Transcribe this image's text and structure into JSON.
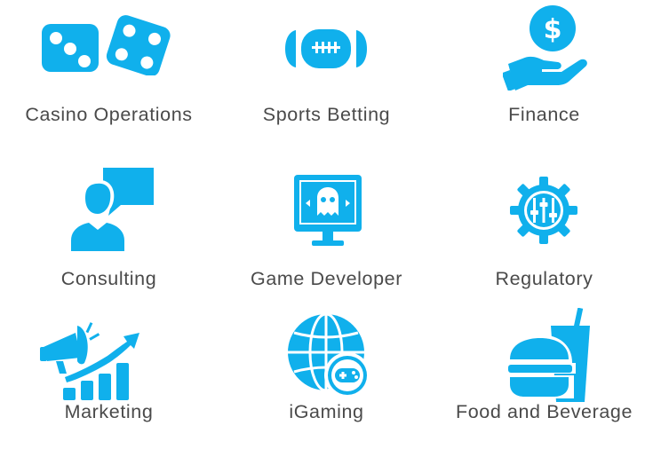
{
  "categories": [
    {
      "label": "Casino Operations",
      "icon": "dice-icon"
    },
    {
      "label": "Sports Betting",
      "icon": "football-icon"
    },
    {
      "label": "Finance",
      "icon": "dollar-coin-hand-icon"
    },
    {
      "label": "Consulting",
      "icon": "person-speech-bubble-icon"
    },
    {
      "label": "Game Developer",
      "icon": "monitor-ghost-icon"
    },
    {
      "label": "Regulatory",
      "icon": "gear-sliders-icon"
    },
    {
      "label": "Marketing",
      "icon": "megaphone-growth-chart-icon"
    },
    {
      "label": "iGaming",
      "icon": "globe-gamepad-icon"
    },
    {
      "label": "Food and Beverage",
      "icon": "burger-drink-icon"
    }
  ],
  "colors": {
    "icon": "#10b0ec",
    "label_text": "#4a4a4a",
    "background": "#ffffff"
  }
}
